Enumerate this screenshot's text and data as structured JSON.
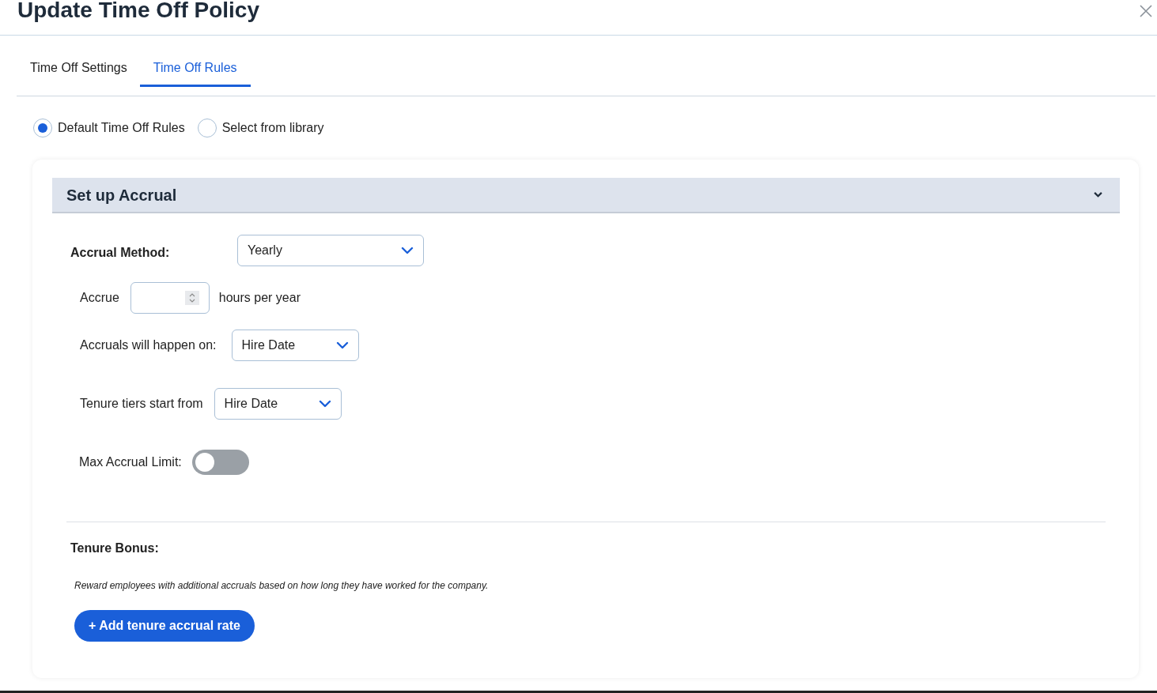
{
  "window": {
    "title": "Update Time Off Policy"
  },
  "tabs": [
    {
      "label": "Time Off Settings",
      "selected": false
    },
    {
      "label": "Time Off Rules",
      "selected": true
    }
  ],
  "rule_source": [
    {
      "label": "Default Time Off Rules",
      "selected": true
    },
    {
      "label": "Select from library",
      "selected": false
    }
  ],
  "accordion": {
    "title": "Set up Accrual",
    "expanded": true
  },
  "accrual_method": {
    "label": "Accrual Method:",
    "value": "Yearly"
  },
  "accrue": {
    "label": "Accrue",
    "suffix": "hours per year"
  },
  "accrual_date": {
    "label": "Accruals will happen on:",
    "value": "Hire Date"
  },
  "tenure_start": {
    "label": "Tenure tiers start from",
    "value": "Hire Date"
  },
  "max_accrual_limit": {
    "label": "Max Accrual Limit:",
    "on": false
  },
  "tenure_bonus": {
    "title": "Tenure Bonus:",
    "description": "Reward employees with additional accruals based on how long they have worked for the company.",
    "button": "+ Add tenure accrual rate"
  }
}
